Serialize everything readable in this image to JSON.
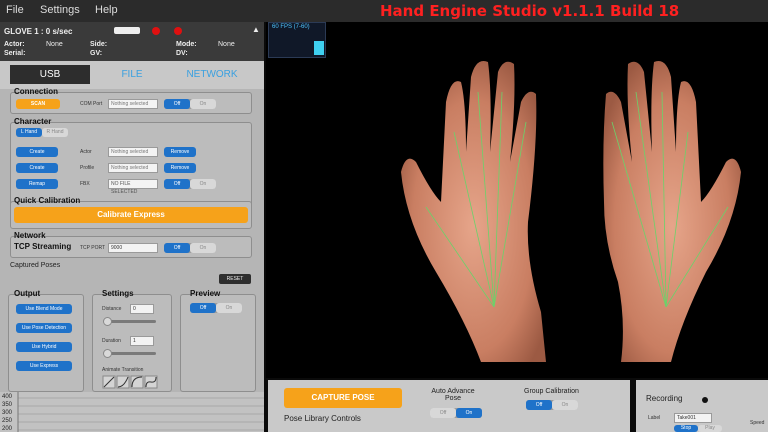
{
  "menu": {
    "file": "File",
    "settings": "Settings",
    "help": "Help"
  },
  "app_title": "Hand Engine Studio v1.1.1 Build 18",
  "glove": {
    "title": "GLOVE 1 : 0 s/sec",
    "actor_label": "Actor:",
    "actor_value": "None",
    "serial_label": "Serial:",
    "side_label": "Side:",
    "gv_label": "GV:",
    "mode_label": "Mode:",
    "mode_value": "None",
    "dv_label": "DV:"
  },
  "tabs": {
    "usb": "USB",
    "file": "FILE",
    "network": "NETWORK"
  },
  "connection": {
    "title": "Connection",
    "scan": "SCAN",
    "com_port_label": "COM Port",
    "com_port_value": "Nothing selected",
    "toggle_on": "Off",
    "toggle_off": "On"
  },
  "character": {
    "title": "Character",
    "l_hand": "L Hand",
    "r_hand": "R Hand",
    "create1": "Create",
    "actor_label": "Actor",
    "actor_value": "Nothing selected",
    "remove1": "Remove",
    "create2": "Create",
    "profile_label": "Profile",
    "profile_value": "Nothing selected",
    "remove2": "Remove",
    "remap": "Remap",
    "fbx_label": "FBX",
    "fbx_value": "NO FILE SELECTED",
    "toggle_on": "Off",
    "toggle_off": "On"
  },
  "quick_calibration": {
    "title": "Quick Calibration",
    "button": "Calibrate Express"
  },
  "network": {
    "title": "Network",
    "tcp_label": "TCP Streaming",
    "port_label": "TCP PORT",
    "port_value": "9000",
    "toggle_on": "Off",
    "toggle_off": "On"
  },
  "captured_poses": {
    "title": "Captured Poses",
    "reset": "RESET"
  },
  "output": {
    "title": "Output",
    "b1": "Use Blend Mode",
    "b2": "Use Pose Detection",
    "b3": "Use Hybrid",
    "b4": "Use Express"
  },
  "settings": {
    "title": "Settings",
    "distance_label": "Distance",
    "distance_value": "0",
    "duration_label": "Duration",
    "duration_value": "1",
    "animate_label": "Animate Transition"
  },
  "preview": {
    "title": "Preview",
    "toggle_on": "Off",
    "toggle_off": "On"
  },
  "fps": {
    "label": "60 FPS (7-60)"
  },
  "bottom": {
    "capture_pose": "CAPTURE POSE",
    "auto_advance": "Auto Advance Pose",
    "auto_off": "Off",
    "auto_on": "On",
    "group_calibration": "Group Calibration",
    "group_off": "Off",
    "group_on": "On",
    "pose_library": "Pose Library Controls",
    "recording": "Recording",
    "label_label": "Label",
    "label_value": "Take001",
    "stop": "Stop",
    "play": "Play",
    "speed_label": "Speed"
  },
  "graph": {
    "y400": "400",
    "y350": "350",
    "y300": "300",
    "y250": "250",
    "y200": "200"
  },
  "colors": {
    "accent_blue": "#1f72c9",
    "accent_orange": "#f6a21a",
    "title_red": "#ff2020"
  }
}
